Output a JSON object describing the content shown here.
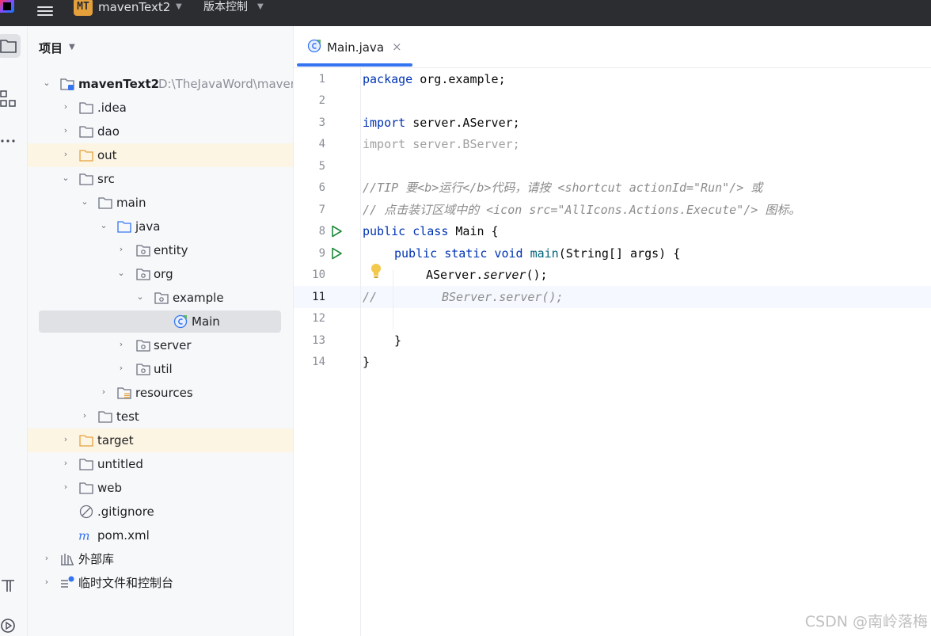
{
  "topbar": {
    "project_badge": "MT",
    "project_name": "mavenText2",
    "vcs_label": "版本控制"
  },
  "project_panel": {
    "title": "项目",
    "tree": [
      {
        "label": "mavenText2",
        "path": "D:\\TheJavaWord\\maven",
        "bold": true,
        "icon": "module-folder-icon"
      },
      {
        "label": ".idea",
        "icon": "folder-icon"
      },
      {
        "label": "dao",
        "icon": "folder-icon"
      },
      {
        "label": "out",
        "icon": "excluded-folder-icon"
      },
      {
        "label": "src",
        "icon": "folder-icon"
      },
      {
        "label": "main",
        "icon": "folder-icon"
      },
      {
        "label": "java",
        "icon": "source-folder-icon"
      },
      {
        "label": "entity",
        "icon": "package-icon"
      },
      {
        "label": "org",
        "icon": "package-icon"
      },
      {
        "label": "example",
        "icon": "package-icon"
      },
      {
        "label": "Main",
        "icon": "java-class-icon"
      },
      {
        "label": "server",
        "icon": "package-icon"
      },
      {
        "label": "util",
        "icon": "package-icon"
      },
      {
        "label": "resources",
        "icon": "resources-folder-icon"
      },
      {
        "label": "test",
        "icon": "folder-icon"
      },
      {
        "label": "target",
        "icon": "excluded-folder-icon"
      },
      {
        "label": "untitled",
        "icon": "folder-icon"
      },
      {
        "label": "web",
        "icon": "folder-icon"
      },
      {
        "label": ".gitignore",
        "icon": "ignore-file-icon"
      },
      {
        "label": "pom.xml",
        "icon": "maven-icon"
      },
      {
        "label": "外部库",
        "icon": "library-icon"
      },
      {
        "label": "临时文件和控制台",
        "icon": "scratches-icon"
      }
    ]
  },
  "editor": {
    "tab_label": "Main.java",
    "tab_close": "×",
    "line_numbers": [
      "1",
      "2",
      "3",
      "4",
      "5",
      "6",
      "7",
      "8",
      "9",
      "10",
      "11",
      "12",
      "13",
      "14"
    ],
    "current_line": 11,
    "code": {
      "l1_kw": "package",
      "l1_rest": " org.example;",
      "l3_kw": "import",
      "l3_rest": " server.AServer;",
      "l4": "import server.BServer;",
      "l6": "//TIP 要<b>运行</b>代码，请按 <shortcut actionId=\"Run\"/> 或",
      "l7": "// 点击装订区域中的 <icon src=\"AllIcons.Actions.Execute\"/> 图标。",
      "l8_kw": "public class",
      "l8_rest": " Main {",
      "l9_kw": "public static void",
      "l9_fn": " main",
      "l9_rest": "(String[] args) {",
      "l10_obj": "AServer.",
      "l10_call": "server",
      "l10_rest": "();",
      "l11_cm": "//",
      "l11_rest": "BServer.server();",
      "l13": "}",
      "l14": "}"
    }
  },
  "watermark": "CSDN @南岭落梅",
  "colors": {
    "topbar_bg": "#2b2d30",
    "keyword": "#0033b3",
    "comment": "#8c8c8c",
    "accent": "#3574f0",
    "excluded_highlight": "#fdf5e4"
  }
}
